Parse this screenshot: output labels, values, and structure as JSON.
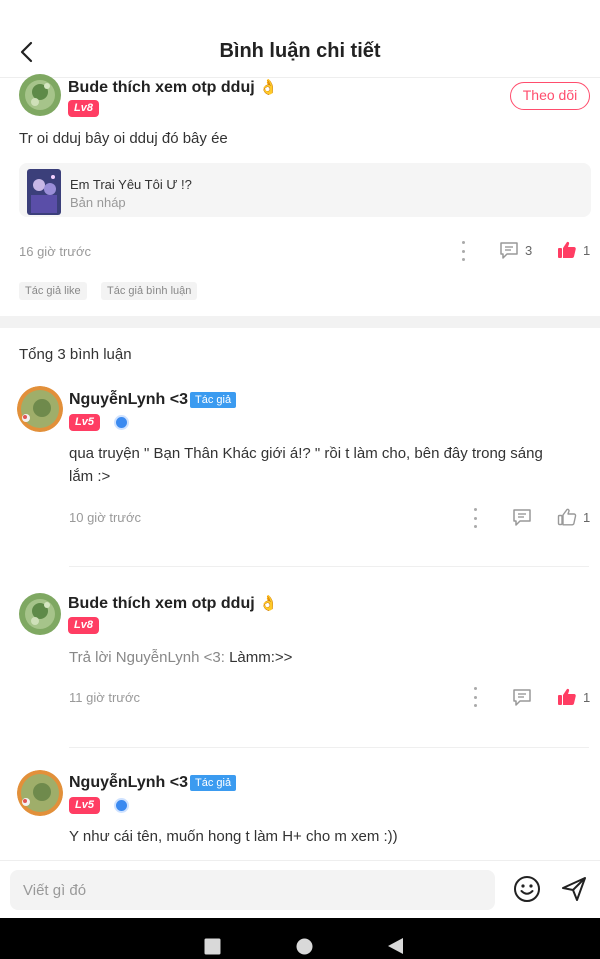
{
  "header": {
    "title": "Bình luận chi tiết",
    "back_icon": "chevron-left-icon"
  },
  "post": {
    "author": "Bude thích xem otp dduj",
    "author_emoji": "👌",
    "level": "Lv8",
    "follow_label": "Theo dõi",
    "text": "Tr oi dduj bây oi dduj đó bây ée",
    "story": {
      "title": "Em Trai Yêu Tôi Ư !?",
      "subtitle": "Bản nháp"
    },
    "time": "16 giờ trước",
    "comment_count": "3",
    "like_count": "1",
    "tags": [
      "Tác giả like",
      "Tác giả bình luận"
    ]
  },
  "total_comments": "Tổng 3 bình luận",
  "comments": [
    {
      "author": "NguyễnLynh <3",
      "badge": "Tác giả",
      "level": "Lv5",
      "text": "qua truyện \" Bạn Thân Khác giới á!? \" rồi t làm cho, bên đây trong sáng lắm :>",
      "time": "10 giờ trước",
      "like_count": "1",
      "liked": false
    },
    {
      "author": "Bude thích xem otp dduj",
      "author_emoji": "👌",
      "level": "Lv8",
      "reply_prefix": "Trả lời NguyễnLynh <3:",
      "text": "Làmm:>>",
      "time": "11 giờ trước",
      "like_count": "1",
      "liked": true
    },
    {
      "author": "NguyễnLynh <3",
      "badge": "Tác giả",
      "level": "Lv5",
      "text": "Y như cái tên, muốn hong t làm H+ cho m xem :))"
    }
  ],
  "composer": {
    "placeholder": "Viết gì đó"
  },
  "colors": {
    "accent": "#ff3d63",
    "badge_blue": "#3b9bf0",
    "text": "#222222",
    "muted": "#999999"
  }
}
